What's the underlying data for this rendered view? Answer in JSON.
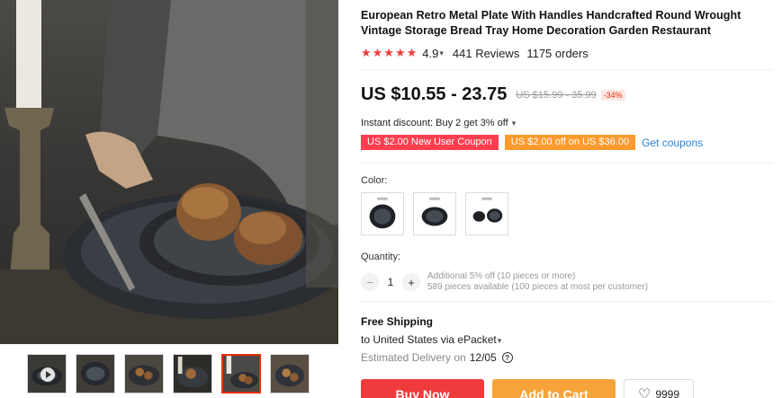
{
  "product": {
    "title": "European Retro Metal Plate With Handles Handcrafted Round Wrought Vintage Storage Bread Tray Home Decoration Garden Restaurant",
    "stars": "★★★★★",
    "rating": "4.9",
    "reviews": "441 Reviews",
    "orders": "1175 orders"
  },
  "price": {
    "current": "US $10.55 - 23.75",
    "original": "US $15.99 - 35.99",
    "discount": "-34%"
  },
  "promotions": {
    "instant_discount": "Instant discount: Buy 2 get 3% off",
    "coupon_new_user": "US $2.00 New User Coupon",
    "coupon_spend": "US $2.00 off on US $36.00",
    "get_coupons": "Get coupons"
  },
  "color": {
    "label": "Color:"
  },
  "quantity": {
    "label": "Quantity:",
    "minus": "−",
    "value": "1",
    "plus": "+",
    "additional": "Additional 5% off (10 pieces or more)",
    "available": "589 pieces available (100 pieces at most per customer)"
  },
  "shipping": {
    "title": "Free Shipping",
    "destination": "to United States via ePacket",
    "estimated_label": "Estimated Delivery on",
    "estimated_date": "12/05",
    "help": "?"
  },
  "actions": {
    "buy_now": "Buy Now",
    "add_to_cart": "Add to Cart",
    "wishlist_count": "9999",
    "heart": "♡"
  },
  "icons": {
    "star": "star-icon",
    "chevron": "chevron-down-icon",
    "help": "help-circle-icon",
    "heart": "heart-icon",
    "play": "play-icon"
  },
  "colors": {
    "accent_red": "#ef3b3b",
    "accent_orange": "#f6a43a",
    "link_blue": "#2b84d6",
    "star_red": "#f03c3c"
  }
}
